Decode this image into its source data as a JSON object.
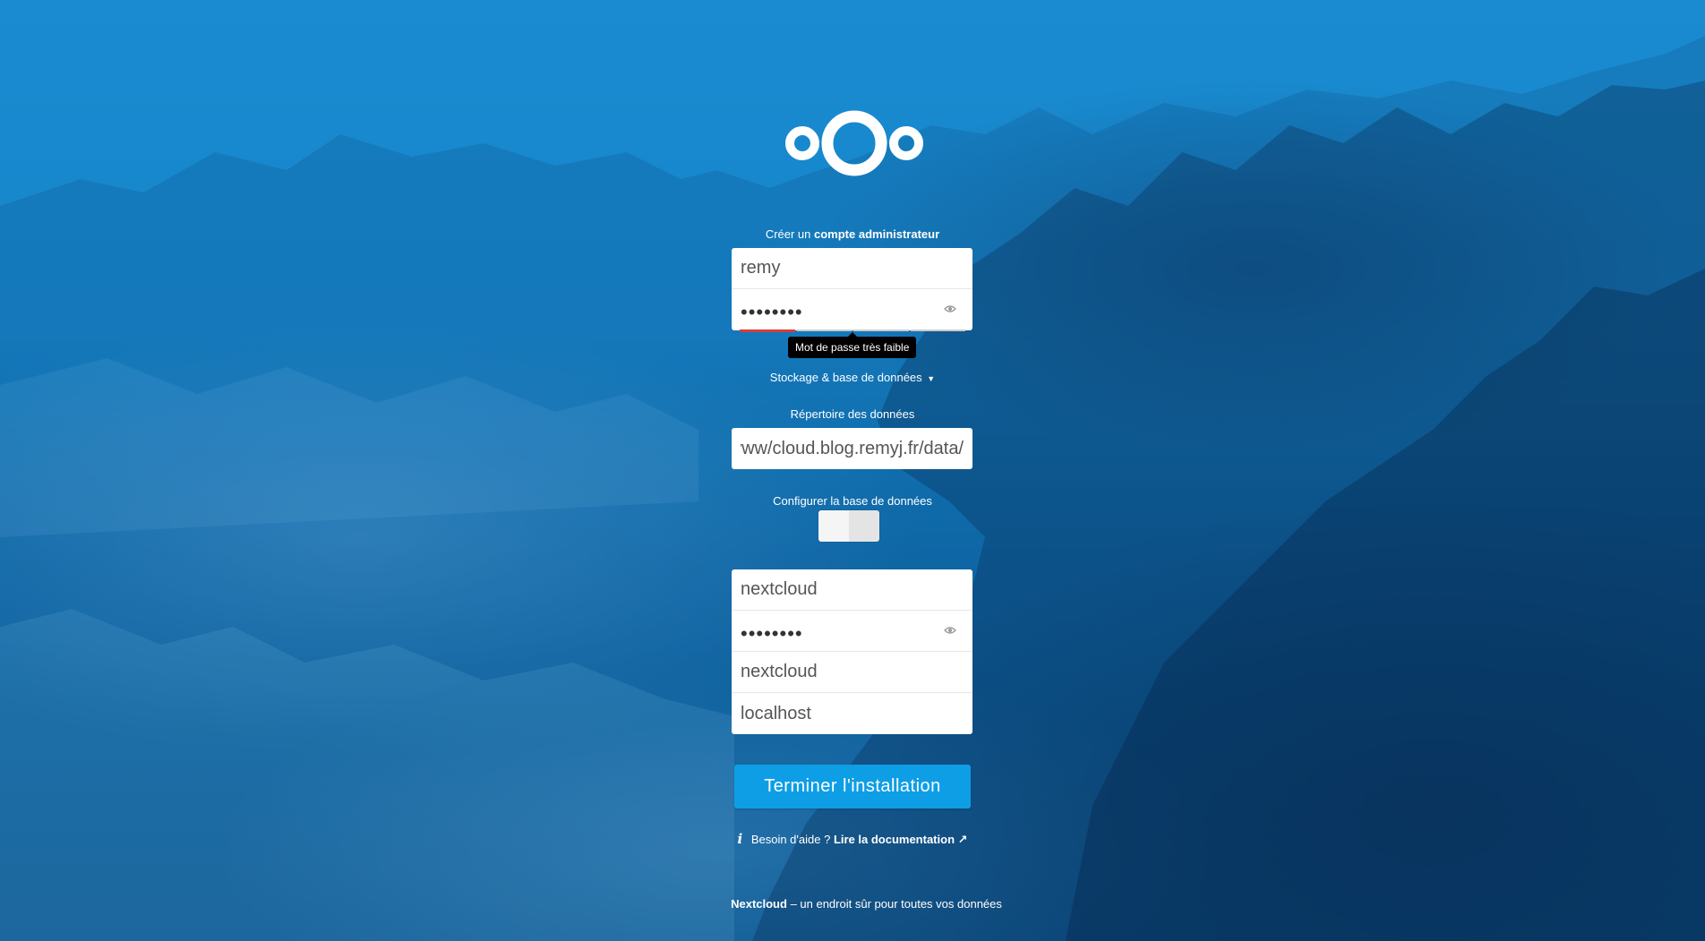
{
  "brand": {
    "logo_icon": "nextcloud-logo-icon"
  },
  "admin": {
    "heading_prefix": "Créer un",
    "heading_bold": "compte administrateur",
    "username_value": "remy",
    "password_dots": "••••••••",
    "password_strength_tooltip": "Mot de passe très faible",
    "password_strength_level": 0.25
  },
  "storage": {
    "toggle_label": "Stockage & base de données",
    "data_dir_label": "Répertoire des données",
    "data_dir_value": "/var/www/cloud.blog.remyj.fr/data"
  },
  "database": {
    "configure_label": "Configurer la base de données",
    "user_value": "nextcloud",
    "password_dots": "••••••••",
    "name_value": "nextcloud",
    "host_value": "localhost"
  },
  "actions": {
    "finish_label": "Terminer l'installation"
  },
  "help": {
    "prefix": "Besoin d'aide ?",
    "link_label": "Lire la documentation ↗"
  },
  "footer": {
    "brand": "Nextcloud",
    "tagline": "– un endroit sûr pour toutes vos données"
  },
  "colors": {
    "background": "#1686cb",
    "button": "#0e9ee6",
    "strength_weak": "#d43f3a"
  }
}
